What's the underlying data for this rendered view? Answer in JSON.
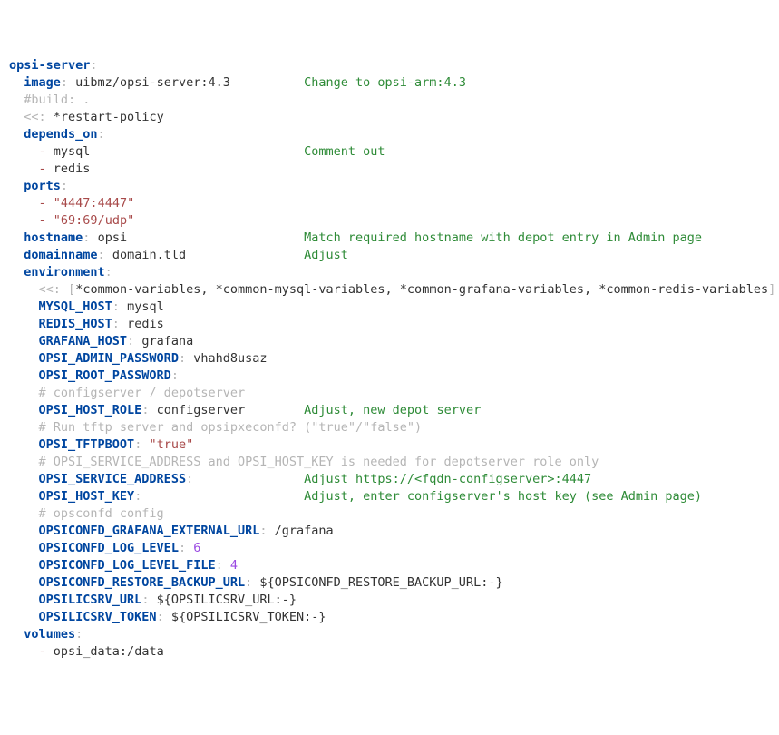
{
  "lines": [
    {
      "indent": 0,
      "frags": [
        {
          "c": "key",
          "t": "opsi-server"
        },
        {
          "c": "punct",
          "t": ":"
        }
      ]
    },
    {
      "indent": 2,
      "frags": [
        {
          "c": "key",
          "t": "image"
        },
        {
          "c": "punct",
          "t": ":"
        },
        {
          "c": "txt",
          "t": " uibmz/opsi-server:4.3"
        }
      ],
      "ann_at": 40,
      "ann": "Change to opsi-arm:4.3"
    },
    {
      "indent": 2,
      "frags": [
        {
          "c": "cmt",
          "t": "#build: ."
        }
      ]
    },
    {
      "indent": 2,
      "frags": [
        {
          "c": "punct",
          "t": "<<:"
        },
        {
          "c": "anc",
          "t": " *restart-policy"
        }
      ]
    },
    {
      "indent": 2,
      "frags": [
        {
          "c": "key",
          "t": "depends_on"
        },
        {
          "c": "punct",
          "t": ":"
        }
      ]
    },
    {
      "indent": 4,
      "frags": [
        {
          "c": "dash",
          "t": "-"
        },
        {
          "c": "txt",
          "t": " mysql"
        }
      ],
      "ann_at": 40,
      "ann": "Comment out"
    },
    {
      "indent": 4,
      "frags": [
        {
          "c": "dash",
          "t": "-"
        },
        {
          "c": "txt",
          "t": " redis"
        }
      ]
    },
    {
      "indent": 2,
      "frags": [
        {
          "c": "key",
          "t": "ports"
        },
        {
          "c": "punct",
          "t": ":"
        }
      ]
    },
    {
      "indent": 4,
      "frags": [
        {
          "c": "dash",
          "t": "-"
        },
        {
          "c": "txt",
          "t": " "
        },
        {
          "c": "str",
          "t": "\"4447:4447\""
        }
      ]
    },
    {
      "indent": 4,
      "frags": [
        {
          "c": "dash",
          "t": "-"
        },
        {
          "c": "txt",
          "t": " "
        },
        {
          "c": "str",
          "t": "\"69:69/udp\""
        }
      ]
    },
    {
      "indent": 2,
      "frags": [
        {
          "c": "key",
          "t": "hostname"
        },
        {
          "c": "punct",
          "t": ":"
        },
        {
          "c": "txt",
          "t": " opsi"
        }
      ],
      "ann_at": 40,
      "ann": "Match required hostname with depot entry in Admin page"
    },
    {
      "indent": 2,
      "frags": [
        {
          "c": "key",
          "t": "domainname"
        },
        {
          "c": "punct",
          "t": ":"
        },
        {
          "c": "txt",
          "t": " domain.tld"
        }
      ],
      "ann_at": 40,
      "ann": "Adjust"
    },
    {
      "indent": 2,
      "frags": [
        {
          "c": "key",
          "t": "environment"
        },
        {
          "c": "punct",
          "t": ":"
        }
      ]
    },
    {
      "indent": 4,
      "frags": [
        {
          "c": "punct",
          "t": "<<:"
        },
        {
          "c": "txt",
          "t": " "
        },
        {
          "c": "punct",
          "t": "["
        },
        {
          "c": "anc",
          "t": "*common-variables, *common-mysql-variables, *common-grafana-variables, *common-redis-variables"
        },
        {
          "c": "punct",
          "t": "]"
        }
      ]
    },
    {
      "indent": 4,
      "frags": [
        {
          "c": "key",
          "t": "MYSQL_HOST"
        },
        {
          "c": "punct",
          "t": ":"
        },
        {
          "c": "txt",
          "t": " mysql"
        }
      ]
    },
    {
      "indent": 4,
      "frags": [
        {
          "c": "key",
          "t": "REDIS_HOST"
        },
        {
          "c": "punct",
          "t": ":"
        },
        {
          "c": "txt",
          "t": " redis"
        }
      ]
    },
    {
      "indent": 4,
      "frags": [
        {
          "c": "key",
          "t": "GRAFANA_HOST"
        },
        {
          "c": "punct",
          "t": ":"
        },
        {
          "c": "txt",
          "t": " grafana"
        }
      ]
    },
    {
      "indent": 4,
      "frags": [
        {
          "c": "key",
          "t": "OPSI_ADMIN_PASSWORD"
        },
        {
          "c": "punct",
          "t": ":"
        },
        {
          "c": "txt",
          "t": " vhahd8usaz"
        }
      ]
    },
    {
      "indent": 4,
      "frags": [
        {
          "c": "key",
          "t": "OPSI_ROOT_PASSWORD"
        },
        {
          "c": "punct",
          "t": ":"
        }
      ]
    },
    {
      "indent": 4,
      "frags": [
        {
          "c": "cmt",
          "t": "# configserver / depotserver"
        }
      ]
    },
    {
      "indent": 4,
      "frags": [
        {
          "c": "key",
          "t": "OPSI_HOST_ROLE"
        },
        {
          "c": "punct",
          "t": ":"
        },
        {
          "c": "txt",
          "t": " configserver"
        }
      ],
      "ann_at": 40,
      "ann": "Adjust, new depot server"
    },
    {
      "indent": 4,
      "frags": [
        {
          "c": "cmt",
          "t": "# Run tftp server and opsipxeconfd? (\"true\"/\"false\")"
        }
      ]
    },
    {
      "indent": 4,
      "frags": [
        {
          "c": "key",
          "t": "OPSI_TFTPBOOT"
        },
        {
          "c": "punct",
          "t": ":"
        },
        {
          "c": "txt",
          "t": " "
        },
        {
          "c": "str",
          "t": "\"true\""
        }
      ]
    },
    {
      "indent": 4,
      "frags": [
        {
          "c": "cmt",
          "t": "# OPSI_SERVICE_ADDRESS and OPSI_HOST_KEY is needed for depotserver role only"
        }
      ]
    },
    {
      "indent": 4,
      "frags": [
        {
          "c": "key",
          "t": "OPSI_SERVICE_ADDRESS"
        },
        {
          "c": "punct",
          "t": ":"
        }
      ],
      "ann_at": 40,
      "ann": "Adjust https://<fqdn-configserver>:4447"
    },
    {
      "indent": 4,
      "frags": [
        {
          "c": "key",
          "t": "OPSI_HOST_KEY"
        },
        {
          "c": "punct",
          "t": ":"
        }
      ],
      "ann_at": 40,
      "ann": "Adjust, enter configserver's host key (see Admin page)"
    },
    {
      "indent": 4,
      "frags": [
        {
          "c": "cmt",
          "t": "# opsconfd config"
        }
      ]
    },
    {
      "indent": 4,
      "frags": [
        {
          "c": "key",
          "t": "OPSICONFD_GRAFANA_EXTERNAL_URL"
        },
        {
          "c": "punct",
          "t": ":"
        },
        {
          "c": "txt",
          "t": " /grafana"
        }
      ]
    },
    {
      "indent": 4,
      "frags": [
        {
          "c": "key",
          "t": "OPSICONFD_LOG_LEVEL"
        },
        {
          "c": "punct",
          "t": ":"
        },
        {
          "c": "txt",
          "t": " "
        },
        {
          "c": "num",
          "t": "6"
        }
      ]
    },
    {
      "indent": 4,
      "frags": [
        {
          "c": "key",
          "t": "OPSICONFD_LOG_LEVEL_FILE"
        },
        {
          "c": "punct",
          "t": ":"
        },
        {
          "c": "txt",
          "t": " "
        },
        {
          "c": "num",
          "t": "4"
        }
      ]
    },
    {
      "indent": 4,
      "frags": [
        {
          "c": "key",
          "t": "OPSICONFD_RESTORE_BACKUP_URL"
        },
        {
          "c": "punct",
          "t": ":"
        },
        {
          "c": "txt",
          "t": " ${OPSICONFD_RESTORE_BACKUP_URL:-}"
        }
      ]
    },
    {
      "indent": 4,
      "frags": [
        {
          "c": "key",
          "t": "OPSILICSRV_URL"
        },
        {
          "c": "punct",
          "t": ":"
        },
        {
          "c": "txt",
          "t": " ${OPSILICSRV_URL:-}"
        }
      ]
    },
    {
      "indent": 4,
      "frags": [
        {
          "c": "key",
          "t": "OPSILICSRV_TOKEN"
        },
        {
          "c": "punct",
          "t": ":"
        },
        {
          "c": "txt",
          "t": " ${OPSILICSRV_TOKEN:-}"
        }
      ]
    },
    {
      "indent": 2,
      "frags": [
        {
          "c": "key",
          "t": "volumes"
        },
        {
          "c": "punct",
          "t": ":"
        }
      ]
    },
    {
      "indent": 4,
      "frags": [
        {
          "c": "dash",
          "t": "-"
        },
        {
          "c": "txt",
          "t": " opsi_data:/data"
        }
      ]
    }
  ]
}
